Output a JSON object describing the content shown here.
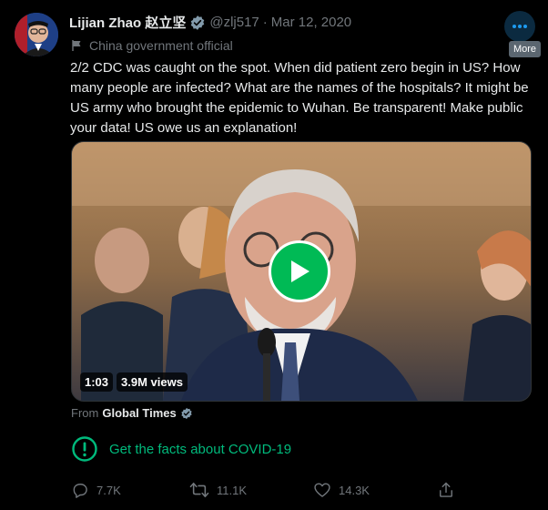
{
  "tweet": {
    "author_name": "Lijian Zhao 赵立坚",
    "handle": "@zlj517",
    "separator": "·",
    "date": "Mar 12, 2020",
    "label": "China government official",
    "text": "2/2 CDC was caught on the spot. When did patient zero begin in US? How many people are infected? What are the names of the hospitals? It might be US army who brought the epidemic to Wuhan. Be transparent! Make public your data! US owe us an explanation!",
    "more_tooltip": "More"
  },
  "video": {
    "duration": "1:03",
    "views": "3.9M views"
  },
  "source": {
    "prefix": "From",
    "name": "Global Times"
  },
  "notice": {
    "text": "Get the facts about COVID-19"
  },
  "actions": {
    "replies": "7.7K",
    "retweets": "11.1K",
    "likes": "14.3K"
  },
  "colors": {
    "background": "#000000",
    "text": "#e7e9ea",
    "muted": "#71767b",
    "covid_green": "#00ba7c",
    "verified_gray": "#829aab",
    "play_green": "#00ba55"
  }
}
